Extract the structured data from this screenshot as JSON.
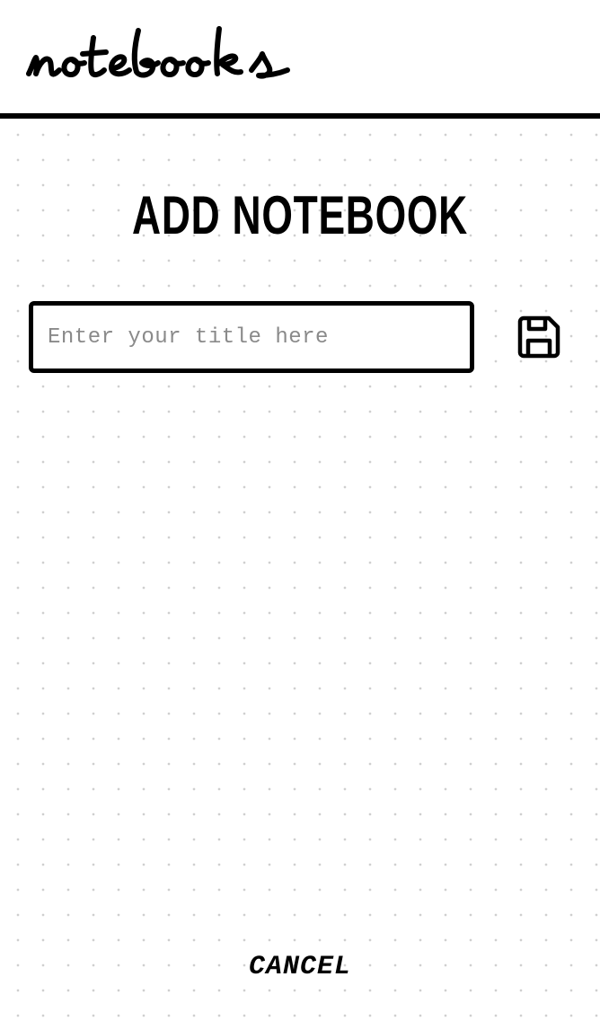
{
  "header": {
    "logo_text": "notebooks",
    "logo_icon": "notebooks-script-logo"
  },
  "main": {
    "title": "ADD NOTEBOOK",
    "title_input": {
      "value": "",
      "placeholder": "Enter your title here"
    },
    "save_icon": "floppy-disk-save-icon",
    "cancel_label": "CANCEL"
  },
  "colors": {
    "ink": "#000000",
    "background": "#ffffff",
    "grid_dot": "#cfcfcf",
    "placeholder": "#8a8a8a"
  }
}
